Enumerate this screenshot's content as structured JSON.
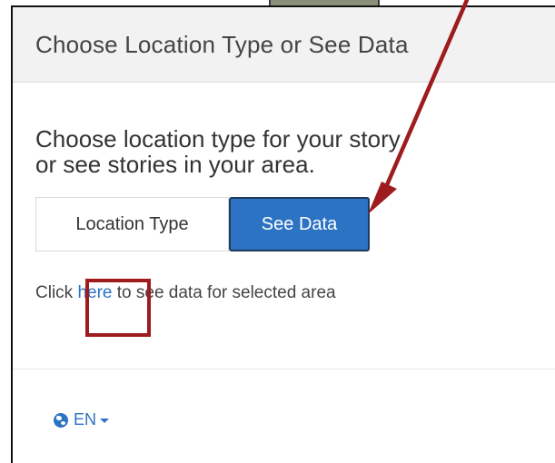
{
  "panel": {
    "title": "Choose Location Type or See Data"
  },
  "body": {
    "prompt_line1": "Choose location type for your story",
    "prompt_line2": "or see stories in your area."
  },
  "toggle": {
    "location_type_label": "Location Type",
    "see_data_label": "See Data",
    "selected": "See Data"
  },
  "click_line": {
    "prefix": "Click ",
    "link_text": "here",
    "suffix": " to see data for selected area"
  },
  "language": {
    "icon": "globe-icon",
    "label": "EN"
  },
  "annotation": {
    "color": "#9e1b1e"
  },
  "colors": {
    "primary": "#2d73c4",
    "header_bg": "#f2f2f2"
  }
}
